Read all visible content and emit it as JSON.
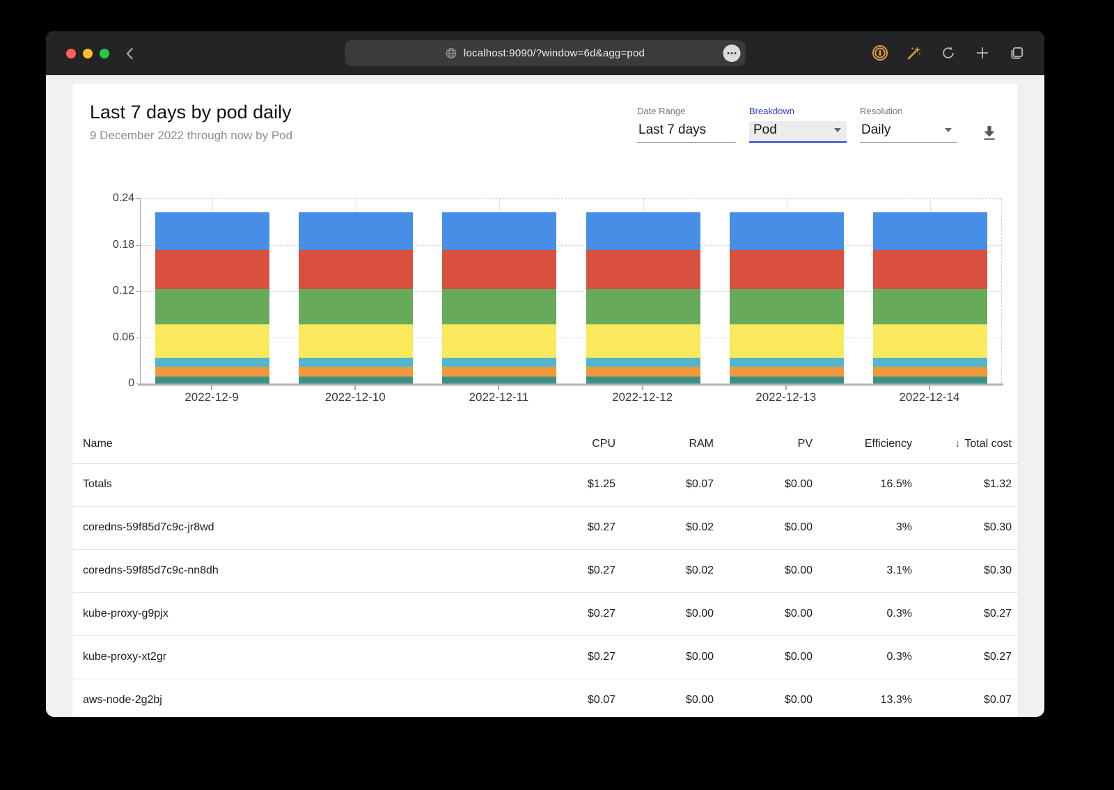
{
  "browser": {
    "url": "localhost:9090/?window=6d&agg=pod",
    "traffic_lights": {
      "close": "#ff5f57",
      "minimize": "#febc2e",
      "zoom": "#28c840"
    },
    "icons": [
      "back-chevron",
      "globe",
      "ellipsis",
      "onepassword",
      "wand-extension",
      "reload",
      "new-tab-plus",
      "tab-overview"
    ]
  },
  "header": {
    "title": "Last 7 days by pod daily",
    "subtitle": "9 December 2022 through now by Pod",
    "controls": {
      "date_range": {
        "label": "Date Range",
        "value": "Last 7 days"
      },
      "breakdown": {
        "label": "Breakdown",
        "value": "Pod",
        "accent": "#2b3fd4"
      },
      "resolution": {
        "label": "Resolution",
        "value": "Daily"
      }
    }
  },
  "chart_data": {
    "type": "bar",
    "stacked": true,
    "title": "",
    "xlabel": "",
    "ylabel": "",
    "ylim": [
      0,
      0.24
    ],
    "yticks": [
      0,
      0.06,
      0.12,
      0.18,
      0.24
    ],
    "grid": "dashed",
    "legend": "none",
    "categories": [
      "2022-12-9",
      "2022-12-10",
      "2022-12-11",
      "2022-12-12",
      "2022-12-13",
      "2022-12-14"
    ],
    "series": [
      {
        "name": "segment-teal",
        "color": "#3B9186",
        "values": [
          0.009,
          0.009,
          0.009,
          0.009,
          0.009,
          0.009
        ]
      },
      {
        "name": "segment-orange",
        "color": "#F0993B",
        "values": [
          0.013,
          0.013,
          0.013,
          0.013,
          0.013,
          0.013
        ]
      },
      {
        "name": "segment-cyan",
        "color": "#54B6CC",
        "values": [
          0.011,
          0.011,
          0.011,
          0.011,
          0.011,
          0.011
        ]
      },
      {
        "name": "segment-yellow",
        "color": "#FAE85D",
        "values": [
          0.044,
          0.044,
          0.044,
          0.044,
          0.044,
          0.044
        ]
      },
      {
        "name": "segment-green",
        "color": "#66AA5A",
        "values": [
          0.046,
          0.046,
          0.046,
          0.046,
          0.046,
          0.046
        ]
      },
      {
        "name": "segment-red",
        "color": "#D9503F",
        "values": [
          0.05,
          0.05,
          0.05,
          0.05,
          0.05,
          0.05
        ]
      },
      {
        "name": "segment-blue",
        "color": "#478FE6",
        "values": [
          0.049,
          0.049,
          0.049,
          0.049,
          0.049,
          0.049
        ]
      }
    ]
  },
  "table": {
    "columns": [
      "Name",
      "CPU",
      "RAM",
      "PV",
      "Efficiency",
      "Total cost"
    ],
    "sort_icon": "↓",
    "sorted_column": "Total cost",
    "rows": [
      {
        "name": "Totals",
        "cpu": "$1.25",
        "ram": "$0.07",
        "pv": "$0.00",
        "efficiency": "16.5%",
        "total": "$1.32"
      },
      {
        "name": "coredns-59f85d7c9c-jr8wd",
        "cpu": "$0.27",
        "ram": "$0.02",
        "pv": "$0.00",
        "efficiency": "3%",
        "total": "$0.30"
      },
      {
        "name": "coredns-59f85d7c9c-nn8dh",
        "cpu": "$0.27",
        "ram": "$0.02",
        "pv": "$0.00",
        "efficiency": "3.1%",
        "total": "$0.30"
      },
      {
        "name": "kube-proxy-g9pjx",
        "cpu": "$0.27",
        "ram": "$0.00",
        "pv": "$0.00",
        "efficiency": "0.3%",
        "total": "$0.27"
      },
      {
        "name": "kube-proxy-xt2gr",
        "cpu": "$0.27",
        "ram": "$0.00",
        "pv": "$0.00",
        "efficiency": "0.3%",
        "total": "$0.27"
      },
      {
        "name": "aws-node-2g2bj",
        "cpu": "$0.07",
        "ram": "$0.00",
        "pv": "$0.00",
        "efficiency": "13.3%",
        "total": "$0.07"
      }
    ]
  }
}
